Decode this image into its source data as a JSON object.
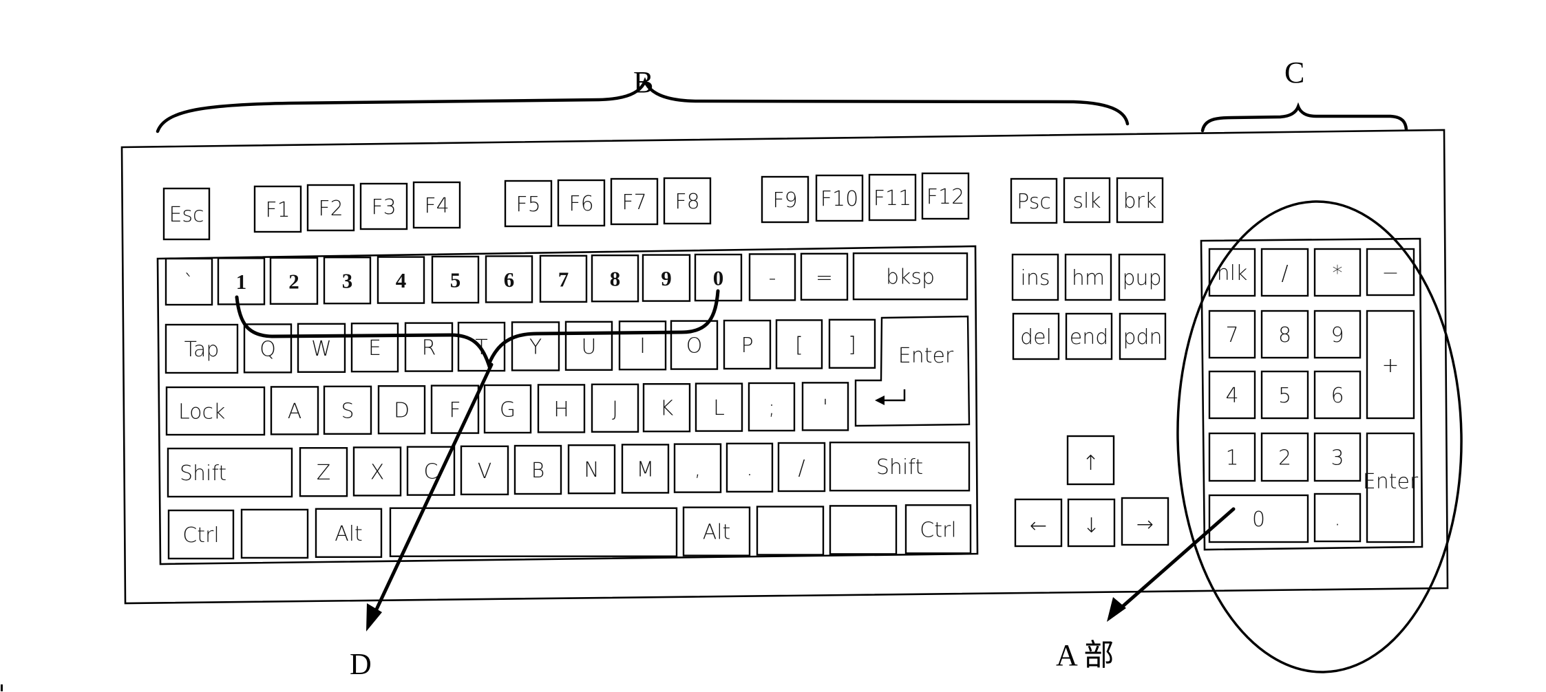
{
  "figure": {
    "labels": {
      "B": "B",
      "C": "C",
      "D": "D",
      "A": "A 部"
    }
  },
  "function_row": [
    "Esc",
    "F1",
    "F2",
    "F3",
    "F4",
    "F5",
    "F6",
    "F7",
    "F8",
    "F9",
    "F10",
    "F11",
    "F12"
  ],
  "system_keys": [
    "Psc",
    "slk",
    "brk"
  ],
  "main_block": {
    "row1": [
      "`",
      "1",
      "2",
      "3",
      "4",
      "5",
      "6",
      "7",
      "8",
      "9",
      "0",
      "-",
      "=",
      "bksp"
    ],
    "row2": [
      "Tap",
      "Q",
      "W",
      "E",
      "R",
      "T",
      "Y",
      "U",
      "I",
      "O",
      "P",
      "[",
      "]",
      "Enter"
    ],
    "row3": [
      "Lock",
      "A",
      "S",
      "D",
      "F",
      "G",
      "H",
      "J",
      "K",
      "L",
      ";",
      "'",
      "↵"
    ],
    "row4": [
      "Shift",
      "Z",
      "X",
      "C",
      "V",
      "B",
      "N",
      "M",
      ",",
      ".",
      "/",
      "Shift"
    ],
    "row5": [
      "Ctrl",
      "",
      "Alt",
      "",
      "Alt",
      "",
      "",
      "Ctrl"
    ]
  },
  "nav_block": {
    "row1": [
      "ins",
      "hm",
      "pup"
    ],
    "row2": [
      "del",
      "end",
      "pdn"
    ]
  },
  "arrow_keys": {
    "up": "↑",
    "left": "←",
    "down": "↓",
    "right": "→"
  },
  "numpad": {
    "row1": [
      "nlk",
      "/",
      "*",
      "−"
    ],
    "row2": [
      "7",
      "8",
      "9",
      "+"
    ],
    "row3": [
      "4",
      "5",
      "6"
    ],
    "row4": [
      "1",
      "2",
      "3",
      "Enter"
    ],
    "row5": [
      "0",
      "."
    ]
  }
}
